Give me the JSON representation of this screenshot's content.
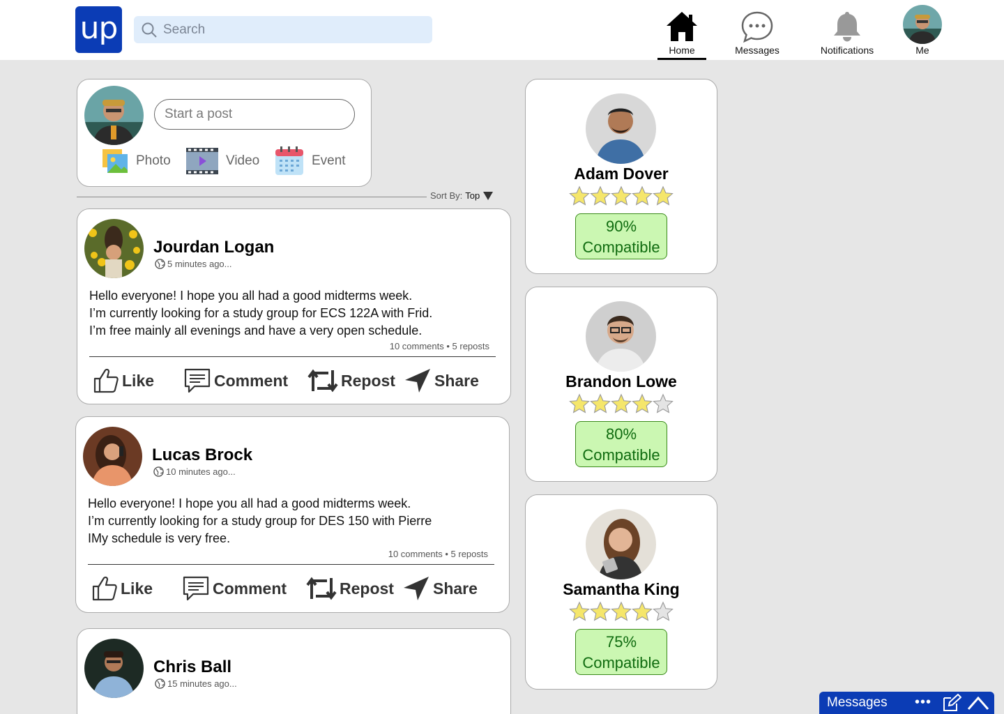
{
  "header": {
    "logo_text": "up",
    "search_placeholder": "Search",
    "nav": [
      {
        "label": "Home",
        "icon": "home-icon",
        "active": true
      },
      {
        "label": "Messages",
        "icon": "chat-bubble-icon"
      },
      {
        "label": "Notifications",
        "icon": "bell-icon"
      },
      {
        "label": "Me",
        "icon": "avatar"
      }
    ]
  },
  "composer": {
    "placeholder": "Start a post",
    "photo_label": "Photo",
    "video_label": "Video",
    "event_label": "Event"
  },
  "sort": {
    "label": "Sort By:",
    "value": "Top"
  },
  "posts": [
    {
      "author": "Jourdan Logan",
      "time": "5 minutes ago...",
      "lines": [
        "Hello everyone! I hope you all had a good midterms week.",
        "I’m currently looking for a study group for ECS 122A with Frid.",
        "I’m free mainly all evenings and have a very open schedule."
      ],
      "stats": "10 comments • 5 reposts"
    },
    {
      "author": "Lucas Brock",
      "time": "10 minutes ago...",
      "lines": [
        "Hello everyone! I hope you all had a good midterms week.",
        "I’m currently looking for a study group for DES 150 with Pierre",
        "IMy schedule is very free."
      ],
      "stats": "10 comments • 5 reposts"
    },
    {
      "author": "Chris Ball",
      "time": "15 minutes ago..."
    }
  ],
  "actions": {
    "like": "Like",
    "comment": "Comment",
    "repost": "Repost",
    "share": "Share"
  },
  "matches": [
    {
      "name": "Adam Dover",
      "rating": 5,
      "percent": "90%",
      "label": "Compatible"
    },
    {
      "name": "Brandon Lowe",
      "rating": 4,
      "percent": "80%",
      "label": "Compatible"
    },
    {
      "name": "Samantha King",
      "rating": 4,
      "percent": "75%",
      "label": "Compatible"
    }
  ],
  "dock": {
    "label": "Messages",
    "more": "•••"
  },
  "colors": {
    "brand": "#0b3cb5",
    "search_bg": "#e0edfb",
    "compat_bg": "#cbf7b2",
    "compat_text": "#0f6b0f",
    "star": "#f5e66b"
  }
}
